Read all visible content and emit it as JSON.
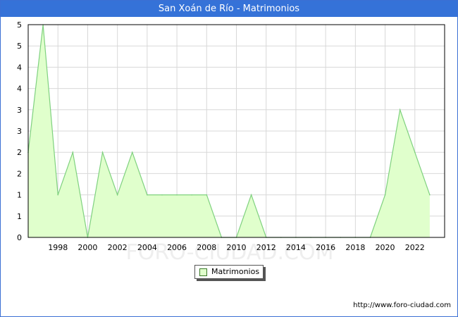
{
  "title": "San Xoán de Río - Matrimonios",
  "source_url": "http://www.foro-ciudad.com",
  "watermark": "FORO-CIUDAD.COM",
  "colors": {
    "title_bg": "#3572d8",
    "fill": "#e0ffcc",
    "line": "#7fd17f",
    "grid": "#d8d8d8"
  },
  "chart_data": {
    "type": "area",
    "title": "San Xoán de Río - Matrimonios",
    "series": [
      {
        "name": "Matrimonios",
        "x": [
          1996,
          1997,
          1998,
          1999,
          2000,
          2001,
          2002,
          2003,
          2004,
          2005,
          2006,
          2007,
          2008,
          2009,
          2010,
          2011,
          2012,
          2013,
          2014,
          2015,
          2016,
          2017,
          2018,
          2019,
          2020,
          2021,
          2022,
          2023
        ],
        "values": [
          2,
          5,
          1,
          2,
          0,
          2,
          1,
          2,
          1,
          1,
          1,
          1,
          1,
          0,
          0,
          1,
          0,
          0,
          0,
          0,
          0,
          0,
          0,
          0,
          1,
          3,
          2,
          1
        ]
      }
    ],
    "xlim": [
      1996,
      2024
    ],
    "ylim": [
      0,
      5
    ],
    "x_ticks": [
      "1998",
      "2000",
      "2002",
      "2004",
      "2006",
      "2008",
      "2010",
      "2012",
      "2014",
      "2016",
      "2018",
      "2020",
      "2022"
    ],
    "y_ticks": [
      "0",
      "1",
      "1",
      "2",
      "2",
      "3",
      "3",
      "4",
      "4",
      "5",
      "5"
    ],
    "grid": true,
    "legend": "bottom-center"
  }
}
